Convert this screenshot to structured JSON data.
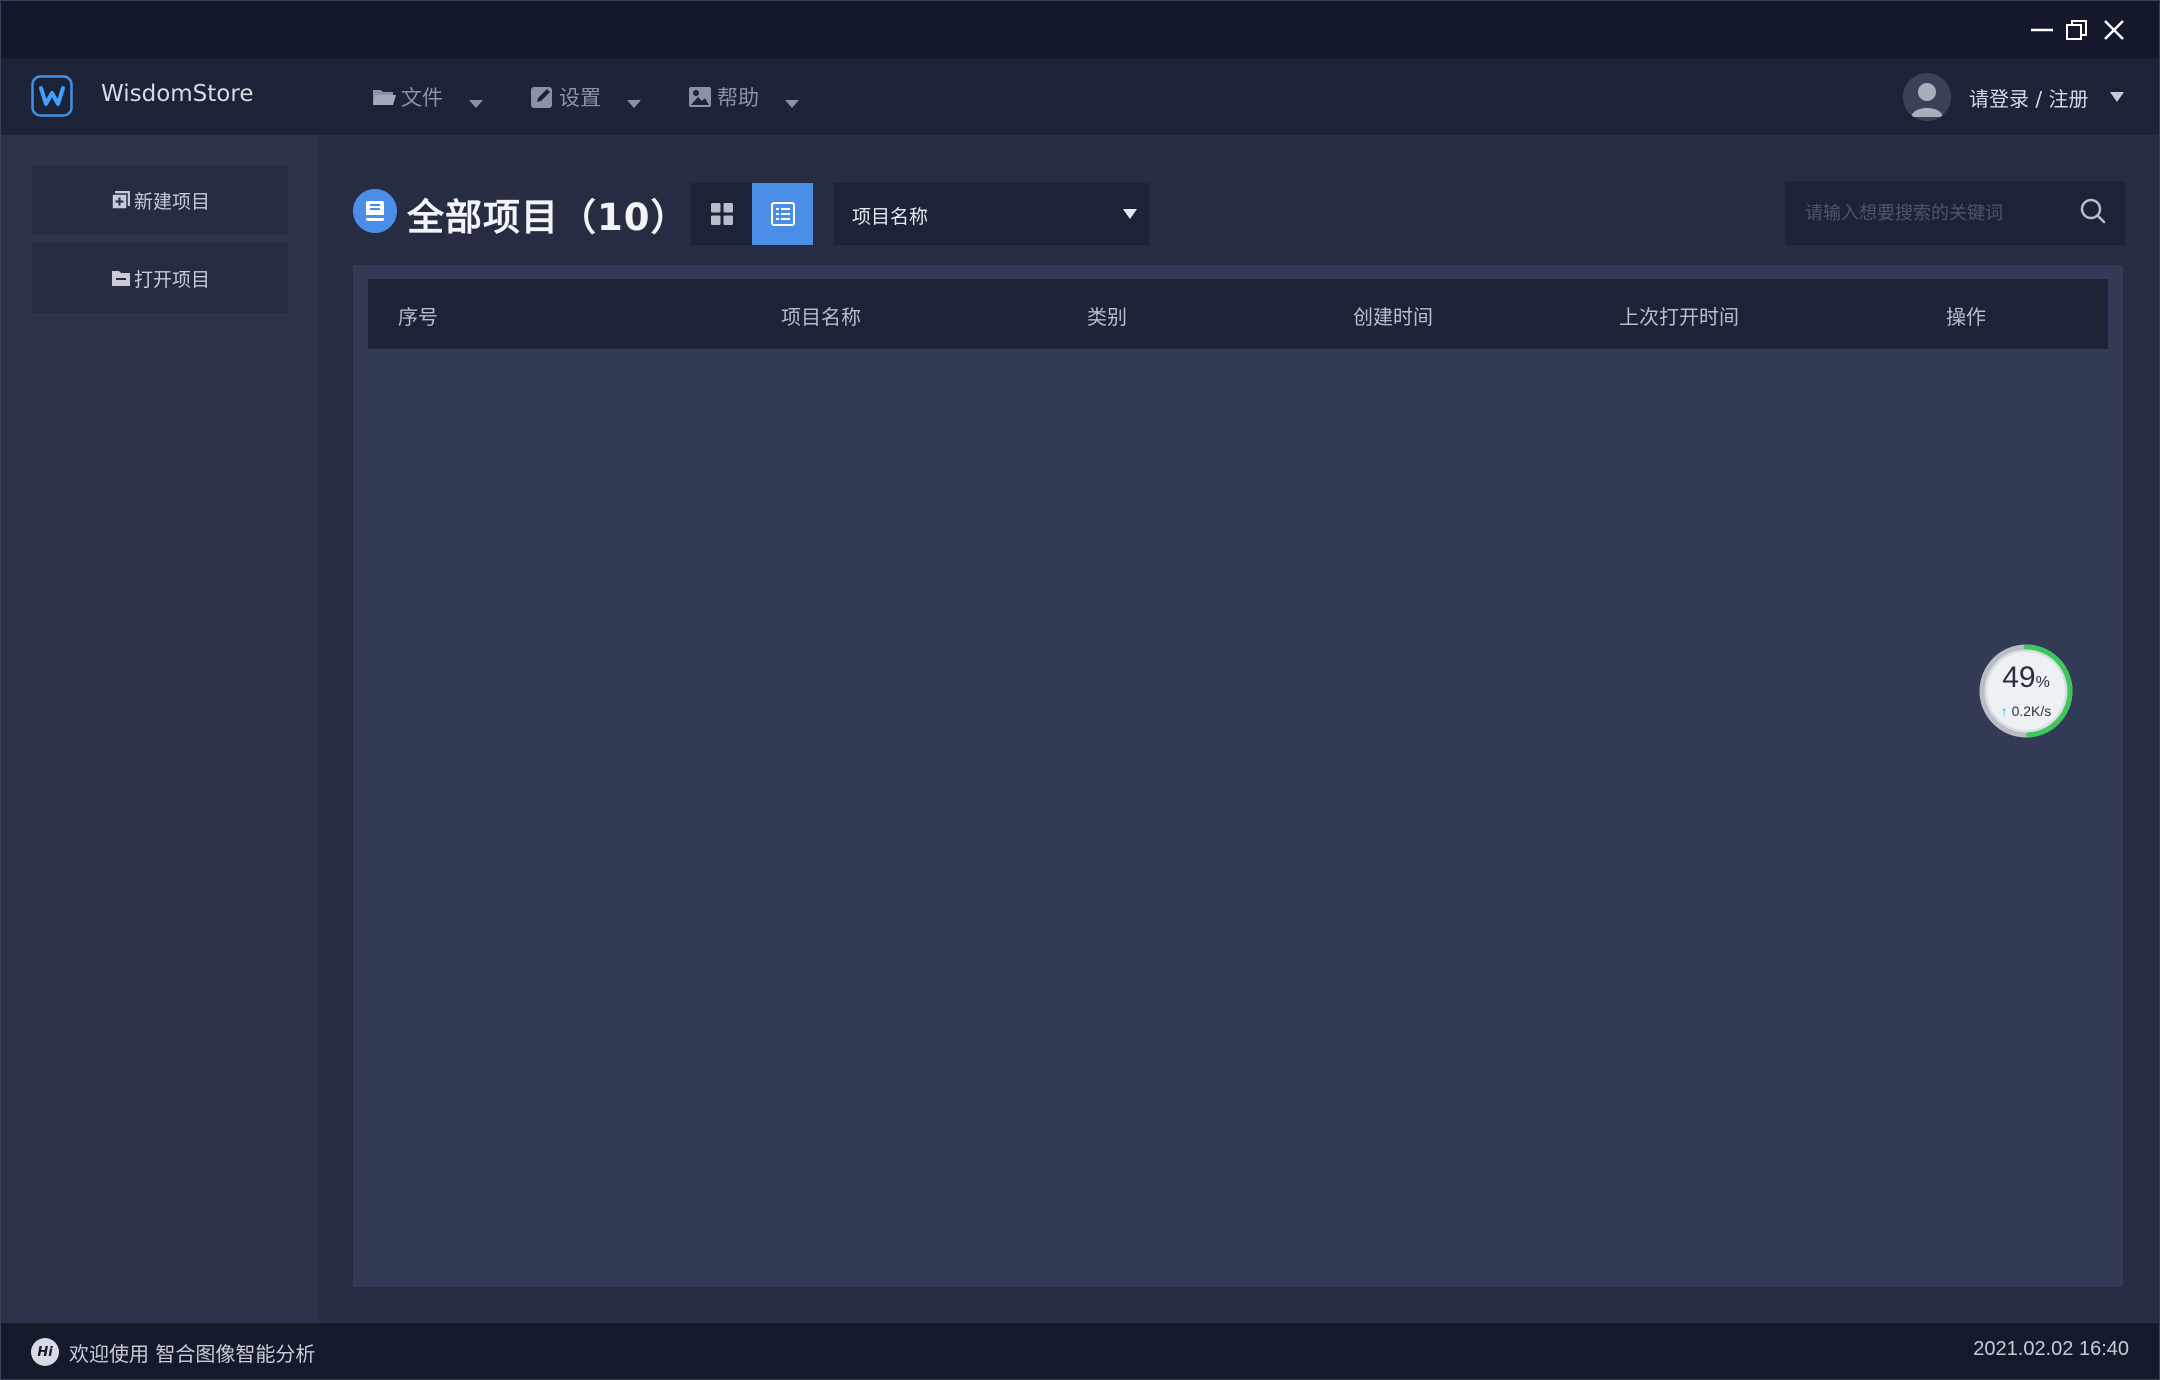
{
  "app": {
    "name": "WisdomStore"
  },
  "menu": {
    "file_label": "文件",
    "settings_label": "设置",
    "help_label": "帮助"
  },
  "user": {
    "login_label": "请登录 / 注册"
  },
  "sidebar": {
    "items": [
      {
        "label": "新建项目",
        "icon": "new-project-icon"
      },
      {
        "label": "打开项目",
        "icon": "open-folder-icon"
      }
    ]
  },
  "main": {
    "title": "全部项目（10）",
    "view_mode": "list",
    "filter": {
      "selected": "项目名称"
    },
    "search": {
      "placeholder": "请输入想要搜索的关键词",
      "value": ""
    },
    "table": {
      "columns": [
        "序号",
        "项目名称",
        "类别",
        "创建时间",
        "上次打开时间",
        "操作"
      ],
      "rows": []
    }
  },
  "network_widget": {
    "percent": "49",
    "percent_unit": "%",
    "percent_value": 0.49,
    "speed": "0.2K/s"
  },
  "statusbar": {
    "welcome": "欢迎使用 智合图像智能分析",
    "badge": "Hi",
    "datetime": "2021.02.02 16:40"
  },
  "colors": {
    "accent": "#4a8ee8",
    "titlebar": "#13182a",
    "menubar": "#1d2336",
    "sidebar": "#2b3249",
    "panel": "#333a55",
    "ring_green": "#3cc85a"
  }
}
